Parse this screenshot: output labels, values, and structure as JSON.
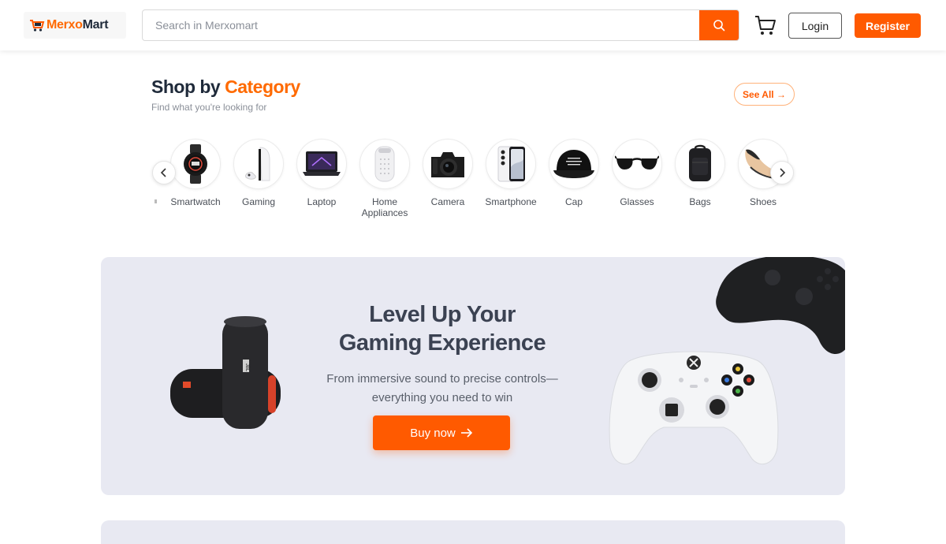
{
  "header": {
    "logo_part1": "Merxo",
    "logo_part2": "Mart",
    "search_placeholder": "Search in Merxomart",
    "search_value": "",
    "login_label": "Login",
    "register_label": "Register"
  },
  "categories": {
    "title_part1": "Shop by",
    "title_part2": "Category",
    "subtitle": "Find what you're looking for",
    "see_all_label": "See All →",
    "items": [
      {
        "label": "Smartwatch"
      },
      {
        "label": "Gaming"
      },
      {
        "label": "Laptop"
      },
      {
        "label": "Home Appliances"
      },
      {
        "label": "Camera"
      },
      {
        "label": "Smartphone"
      },
      {
        "label": "Cap"
      },
      {
        "label": "Glasses"
      },
      {
        "label": "Bags"
      },
      {
        "label": "Shoes"
      }
    ]
  },
  "banner": {
    "heading_line1": "Level Up Your",
    "heading_line2": "Gaming Experience",
    "subtitle_line1": "From immersive sound to precise controls—",
    "subtitle_line2": "everything you need to win",
    "button_label": "Buy now",
    "speaker_brand": "JBL"
  },
  "colors": {
    "accent": "#ff5a00",
    "dark": "#1f2a3a",
    "banner_bg": "#e8e9f2"
  }
}
